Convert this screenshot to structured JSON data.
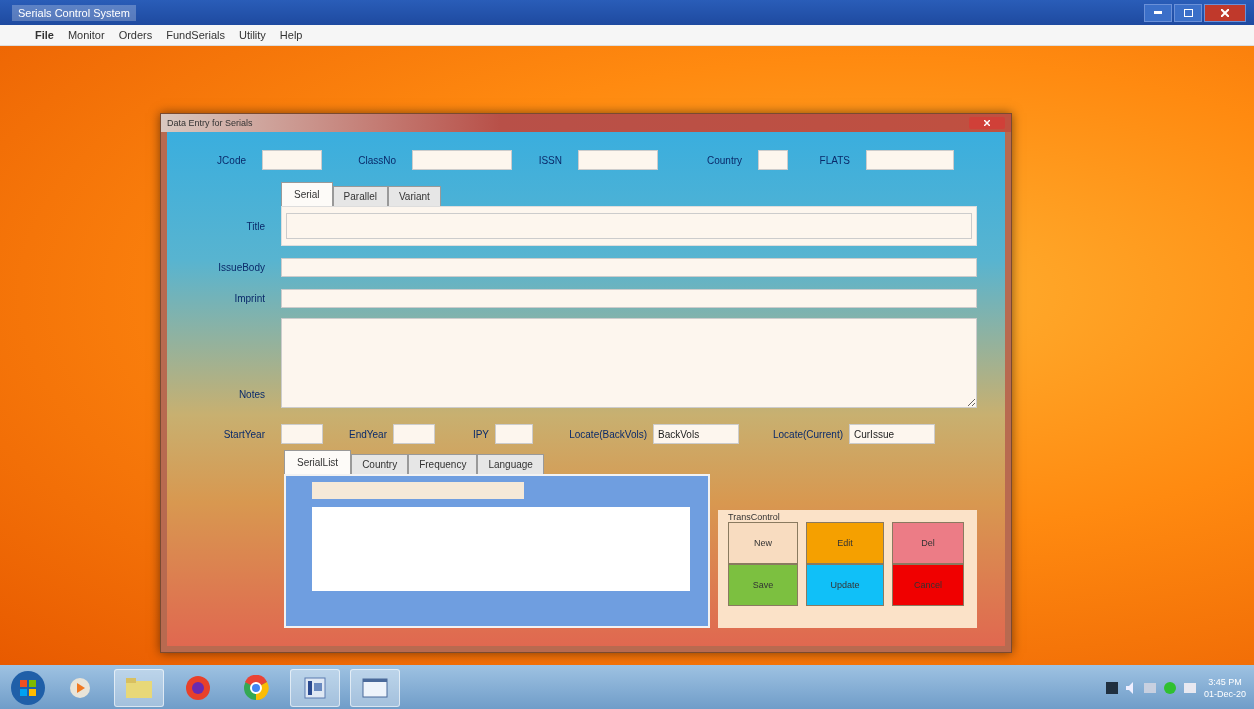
{
  "app_window": {
    "title": "Serials Control System"
  },
  "menu": [
    "File",
    "Monitor",
    "Orders",
    "FundSerials",
    "Utility",
    "Help"
  ],
  "dialog": {
    "title": "Data Entry for Serials",
    "top_fields": [
      {
        "label": "JCode"
      },
      {
        "label": "ClassNo"
      },
      {
        "label": "ISSN"
      },
      {
        "label": "Country"
      },
      {
        "label": "FLATS"
      }
    ],
    "tabs": [
      {
        "label": "Serial",
        "selected": true
      },
      {
        "label": "Parallel",
        "selected": false
      },
      {
        "label": "Variant",
        "selected": false
      }
    ],
    "text_fields": [
      {
        "label": "Title",
        "kind": "line"
      },
      {
        "label": "IssueBody",
        "kind": "line"
      },
      {
        "label": "Imprint",
        "kind": "line"
      },
      {
        "label": "Notes",
        "kind": "multiline"
      }
    ],
    "year_row": [
      {
        "label": "StartYear"
      },
      {
        "label": "EndYear"
      },
      {
        "label": "IPY"
      },
      {
        "label": "Locate(BackVols)",
        "value": "BackVols"
      },
      {
        "label": "Locate(Current)",
        "value": "CurIssue"
      }
    ],
    "list_tabs": [
      {
        "label": "SerialList",
        "selected": true
      },
      {
        "label": "Country",
        "selected": false
      },
      {
        "label": "Frequency",
        "selected": false
      },
      {
        "label": "Language",
        "selected": false
      }
    ],
    "trans_control": {
      "title": "TransControl",
      "buttons": [
        {
          "label": "New",
          "color": "#f8dcc0"
        },
        {
          "label": "Edit",
          "color": "#f5a000"
        },
        {
          "label": "Del",
          "color": "#ec7c86"
        },
        {
          "label": "Save",
          "color": "#7cc040"
        },
        {
          "label": "Update",
          "color": "#10c0f8"
        },
        {
          "label": "Cancel",
          "color": "#f00000"
        }
      ]
    }
  },
  "taskbar": {
    "time": "3:45 PM",
    "date": "01-Dec-20"
  }
}
